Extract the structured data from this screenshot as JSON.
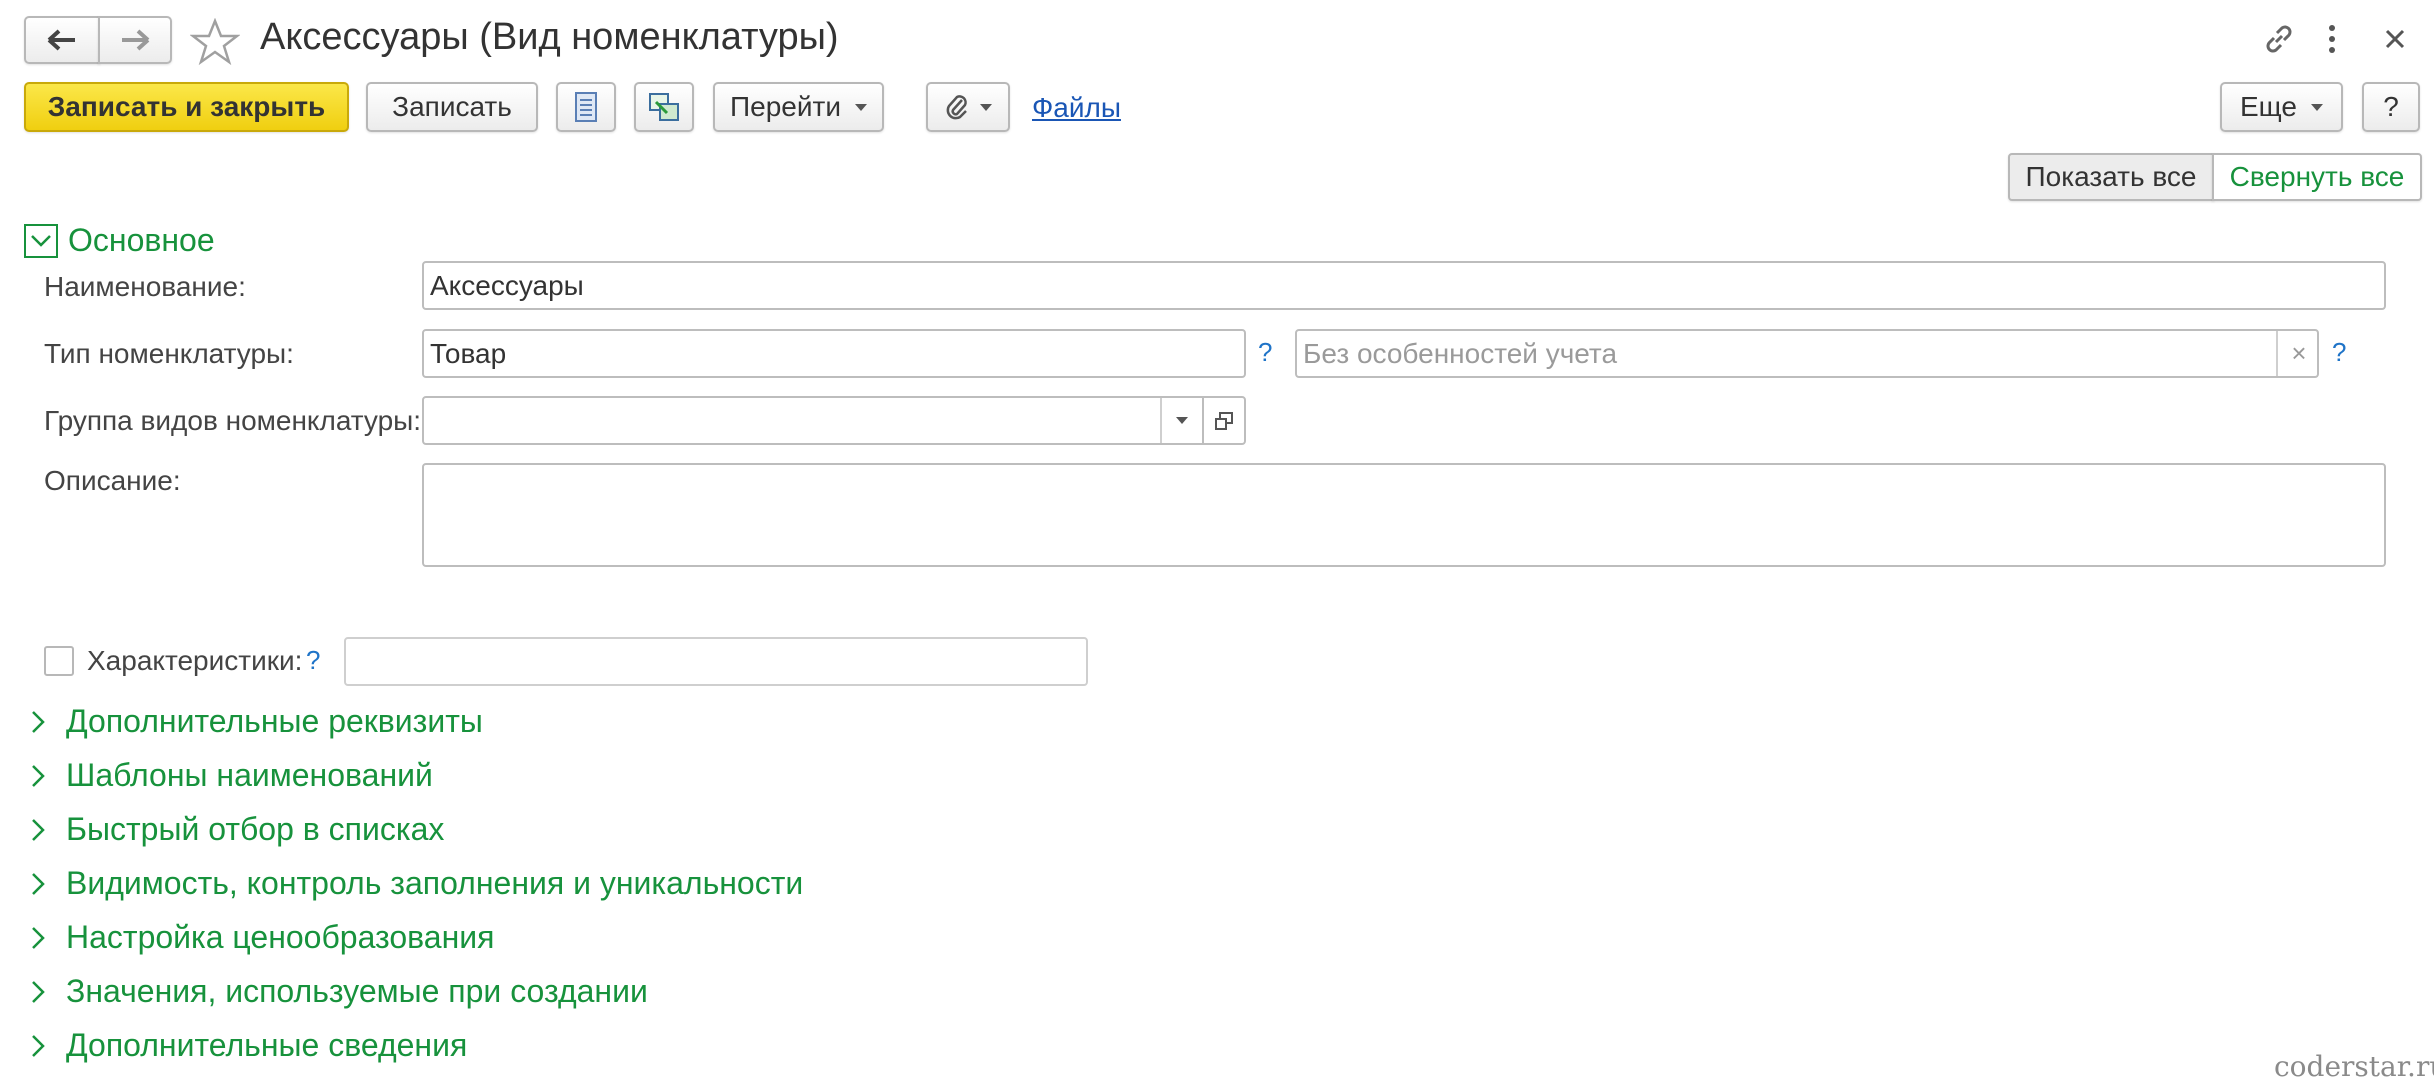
{
  "window": {
    "title": "Аксессуары (Вид номенклатуры)"
  },
  "toolbar": {
    "save_close_label": "Записать и закрыть",
    "save_label": "Записать",
    "goto_label": "Перейти",
    "files_link": "Файлы",
    "more_label": "Еще",
    "help_label": "?"
  },
  "panel_controls": {
    "show_all": "Показать все",
    "collapse_all": "Свернуть все"
  },
  "main_section": {
    "title": "Основное",
    "name_label": "Наименование:",
    "name_value": "Аксессуары",
    "type_label": "Тип номенклатуры:",
    "type_value": "Товар",
    "accounting_placeholder": "Без особенностей учета",
    "group_label": "Группа видов номенклатуры:",
    "group_value": "",
    "description_label": "Описание:",
    "description_value": "",
    "characteristics_label": "Характеристики:",
    "characteristics_value": "",
    "help_mark": "?",
    "clear_mark": "×"
  },
  "collapsed_sections": [
    "Дополнительные реквизиты",
    "Шаблоны наименований",
    "Быстрый отбор в списках",
    "Видимость, контроль заполнения и уникальности",
    "Настройка ценообразования",
    "Значения, используемые при создании",
    "Дополнительные сведения"
  ],
  "watermark": "coderstar.ru",
  "colors": {
    "accent_green": "#17923c",
    "primary_yellow": "#f5d726",
    "link_blue": "#1a56b5"
  }
}
